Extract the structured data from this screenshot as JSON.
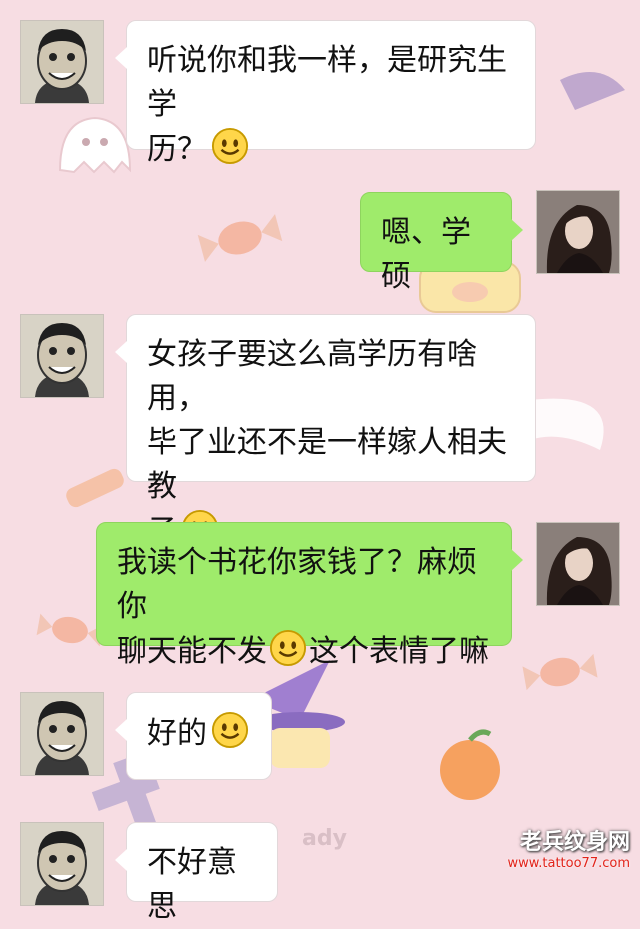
{
  "chat": {
    "messages": [
      {
        "side": "left",
        "text": "听说你和我一样，是研究生学历？",
        "emoji": "smile-emoji"
      },
      {
        "side": "right",
        "text": "嗯、学硕"
      },
      {
        "side": "left",
        "text": "女孩子要这么高学历有啥用，毕了业还不是一样嫁人相夫教子",
        "emoji": "smile-emoji"
      },
      {
        "side": "right",
        "text_before": "我读个书花你家钱了？麻烦你聊天能不发",
        "emoji": "smile-emoji",
        "text_after": "这个表情了嘛"
      },
      {
        "side": "left",
        "text": "好的",
        "emoji": "smile-emoji"
      },
      {
        "side": "left",
        "text": "不好意思"
      }
    ]
  },
  "m1": {
    "line1": "听说你和我一样，是研究生学",
    "line2": "历？"
  },
  "m2": {
    "text": "嗯、学硕"
  },
  "m3": {
    "line1": "女孩子要这么高学历有啥用，",
    "line2": "毕了业还不是一样嫁人相夫教",
    "line3": "子"
  },
  "m4": {
    "line1": "我读个书花你家钱了？麻烦你",
    "line2a": "聊天能不发",
    "line2b": "这个表情了嘛"
  },
  "m5": {
    "text": "好的"
  },
  "m6": {
    "text": "不好意思"
  },
  "background_text": "ady",
  "watermark": {
    "title": "老兵纹身网",
    "url": "www.tattoo77.com"
  },
  "colors": {
    "background": "#f7dde3",
    "left_bubble": "#ffffff",
    "right_bubble": "#9feb6b"
  }
}
